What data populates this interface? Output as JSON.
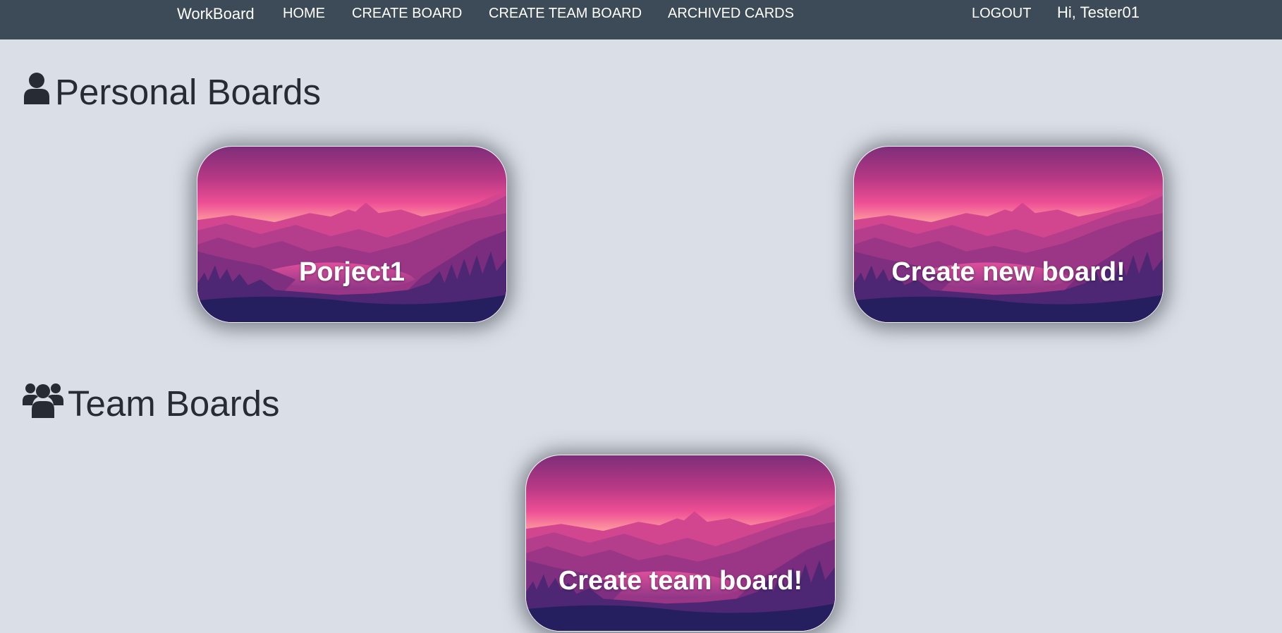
{
  "navbar": {
    "brand": "WorkBoard",
    "links": {
      "home": "HOME",
      "create_board": "CREATE BOARD",
      "create_team_board": "CREATE TEAM BOARD",
      "archived_cards": "ARCHIVED CARDS",
      "logout": "LOGOUT"
    },
    "greeting": "Hi, Tester01"
  },
  "personal_section": {
    "icon": "user-icon",
    "title": "Personal Boards",
    "cards": [
      {
        "label": "Porject1"
      },
      {
        "label": "Create new board!"
      }
    ]
  },
  "team_section": {
    "icon": "users-icon",
    "title": "Team Boards",
    "cards": [
      {
        "label": "Create team board!"
      }
    ]
  },
  "colors": {
    "navbar_bg": "#3d4a57",
    "page_bg": "#dadfe7",
    "heading_text": "#262b34",
    "card_sky_top": "#7e2e7a",
    "card_sky_glow": "#ee4f95",
    "card_horizon": "#ffa3a0",
    "card_deep": "#261f5f"
  }
}
